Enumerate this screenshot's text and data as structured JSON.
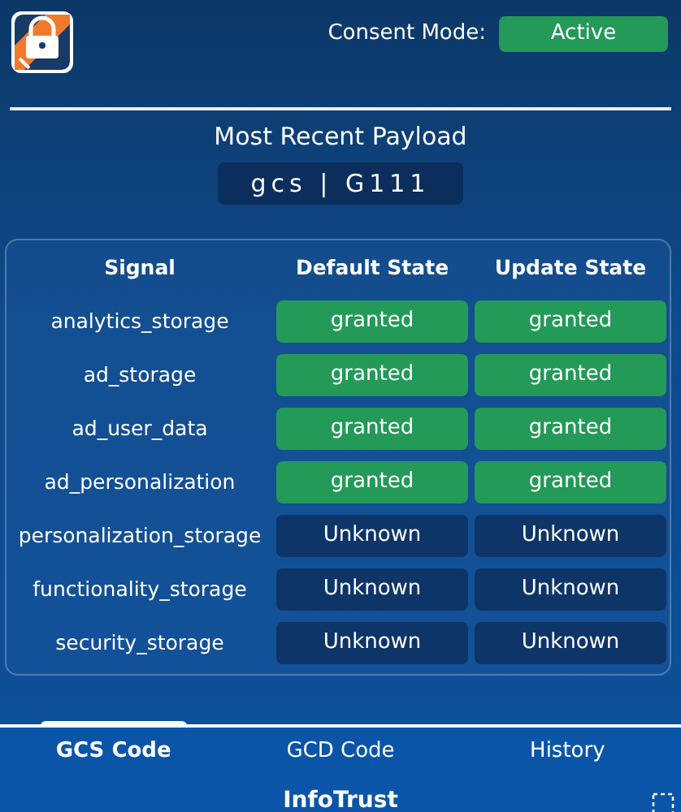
{
  "header": {
    "consent_label": "Consent Mode:",
    "consent_status": "Active"
  },
  "payload": {
    "title": "Most Recent Payload",
    "code": "gcs | G111"
  },
  "table": {
    "columns": [
      "Signal",
      "Default State",
      "Update State"
    ],
    "rows": [
      {
        "signal": "analytics_storage",
        "default": {
          "text": "granted",
          "kind": "granted"
        },
        "update": {
          "text": "granted",
          "kind": "granted"
        }
      },
      {
        "signal": "ad_storage",
        "default": {
          "text": "granted",
          "kind": "granted"
        },
        "update": {
          "text": "granted",
          "kind": "granted"
        }
      },
      {
        "signal": "ad_user_data",
        "default": {
          "text": "granted",
          "kind": "granted"
        },
        "update": {
          "text": "granted",
          "kind": "granted"
        }
      },
      {
        "signal": "ad_personalization",
        "default": {
          "text": "granted",
          "kind": "granted"
        },
        "update": {
          "text": "granted",
          "kind": "granted"
        }
      },
      {
        "signal": "personalization_storage",
        "default": {
          "text": "Unknown",
          "kind": "unknown"
        },
        "update": {
          "text": "Unknown",
          "kind": "unknown"
        }
      },
      {
        "signal": "functionality_storage",
        "default": {
          "text": "Unknown",
          "kind": "unknown"
        },
        "update": {
          "text": "Unknown",
          "kind": "unknown"
        }
      },
      {
        "signal": "security_storage",
        "default": {
          "text": "Unknown",
          "kind": "unknown"
        },
        "update": {
          "text": "Unknown",
          "kind": "unknown"
        }
      }
    ]
  },
  "tabs": [
    {
      "label": "GCS Code",
      "selected": true
    },
    {
      "label": "GCD Code",
      "selected": false
    },
    {
      "label": "History",
      "selected": false
    }
  ],
  "footer": {
    "brand": "InfoTrust"
  }
}
